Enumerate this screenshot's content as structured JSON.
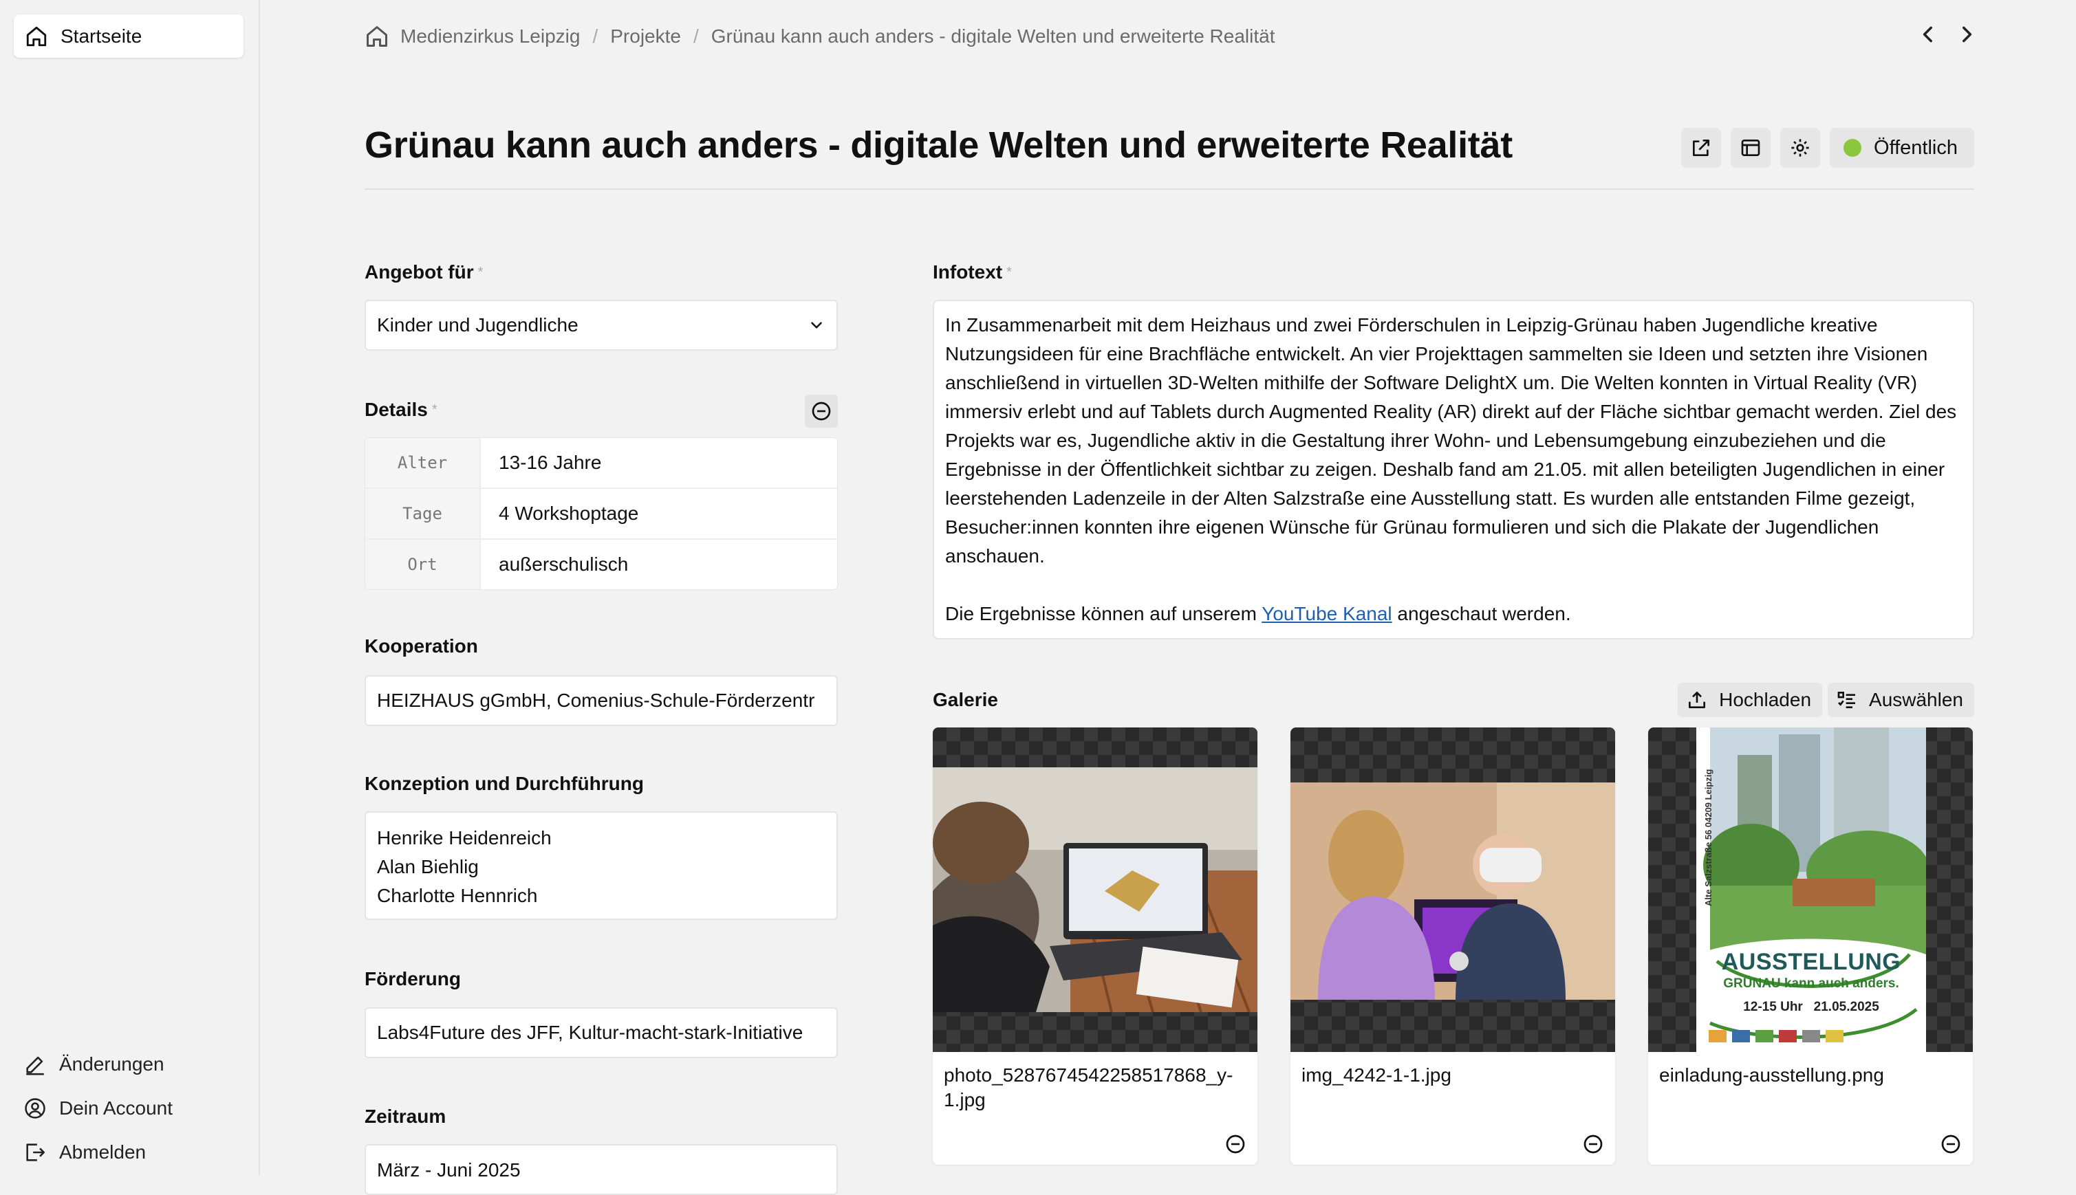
{
  "sidebar": {
    "home_label": "Startseite",
    "links": [
      {
        "label": "Änderungen",
        "icon": "pencil-icon"
      },
      {
        "label": "Dein Account",
        "icon": "user-circle-icon"
      },
      {
        "label": "Abmelden",
        "icon": "logout-icon"
      }
    ]
  },
  "breadcrumb": {
    "items": [
      "Medienzirkus Leipzig",
      "Projekte",
      "Grünau kann auch anders - digitale Welten und erweiterte Realität"
    ],
    "separator": "/"
  },
  "page": {
    "title": "Grünau kann auch anders - digitale Welten und erweiterte Realität",
    "status_label": "Öffentlich",
    "status_color": "#8cc63f"
  },
  "form": {
    "angebot": {
      "label": "Angebot für",
      "required": "*",
      "value": "Kinder und Jugendliche"
    },
    "details": {
      "label": "Details",
      "required": "*",
      "rows": [
        {
          "key": "Alter",
          "value": "13-16 Jahre"
        },
        {
          "key": "Tage",
          "value": "4 Workshoptage"
        },
        {
          "key": "Ort",
          "value": "außerschulisch"
        }
      ]
    },
    "kooperation": {
      "label": "Kooperation",
      "value": "HEIZHAUS gGmbH, Comenius-Schule-Förderzentr"
    },
    "konzeption": {
      "label": "Konzeption und Durchführung",
      "lines": [
        "Henrike Heidenreich",
        "Alan Biehlig",
        "Charlotte Hennrich"
      ]
    },
    "foerderung": {
      "label": "Förderung",
      "value": "Labs4Future des JFF, Kultur-macht-stark-Initiative"
    },
    "zeitraum": {
      "label": "Zeitraum",
      "value": "März - Juni 2025"
    }
  },
  "infotext": {
    "label": "Infotext",
    "required": "*",
    "paragraph1": "In Zusammenarbeit mit dem Heizhaus und zwei Förderschulen in Leipzig-Grünau haben Jugendliche kreative Nutzungsideen für eine Brachfläche entwickelt. An vier Projekttagen sammelten sie Ideen und setzten ihre Visionen anschließend in virtuellen 3D-Welten mithilfe der Software DelightX um. Die Welten konnten in Virtual Reality (VR) immersiv erlebt und auf Tablets durch Augmented Reality (AR) direkt auf der Fläche sichtbar gemacht werden. Ziel des Projekts war es, Jugendliche aktiv in die Gestaltung ihrer Wohn- und Lebensumgebung einzubeziehen und die Ergebnisse in der Öffentlichkeit sichtbar zu zeigen. Deshalb fand am 21.05. mit allen beteiligten Jugendlichen in einer leerstehenden Ladenzeile in der Alten Salzstraße eine Ausstellung statt. Es wurden alle entstanden Filme gezeigt, Besucher:innen konnten ihre eigenen Wünsche für Grünau formulieren und sich die Plakate der Jugendlichen anschauen.",
    "p2_before": "Die Ergebnisse können auf unserem ",
    "p2_link": "YouTube Kanal",
    "p2_after": " angeschaut werden."
  },
  "gallery": {
    "label": "Galerie",
    "upload_label": "Hochladen",
    "select_label": "Auswählen",
    "items": [
      {
        "filename": "photo_5287674542258517868_y-1.jpg"
      },
      {
        "filename": "img_4242-1-1.jpg"
      },
      {
        "filename": "einladung-ausstellung.png"
      }
    ],
    "poster": {
      "title": "AUSSTELLUNG",
      "subtitle": "GRÜNAU kann auch anders.",
      "time": "12-15 Uhr",
      "date": "21.05.2025",
      "address": "Alte Salzstraße 56    04209 Leipzig"
    }
  }
}
